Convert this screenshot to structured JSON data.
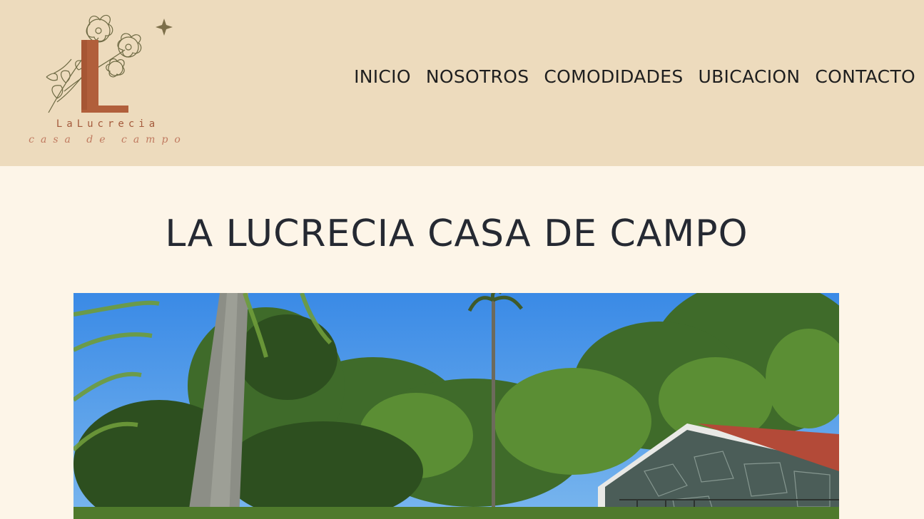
{
  "logo": {
    "name": "LaLucrecia",
    "tagline": "casa de campo"
  },
  "nav": {
    "items": [
      "INICIO",
      "NOSOTROS",
      "COMODIDADES",
      "UBICACION",
      "CONTACTO"
    ]
  },
  "main": {
    "title": "LA LUCRECIA CASA DE CAMPO"
  },
  "colors": {
    "header_bg": "#eddbbd",
    "page_bg": "#fdf5e8",
    "logo_accent": "#b15f3b"
  }
}
